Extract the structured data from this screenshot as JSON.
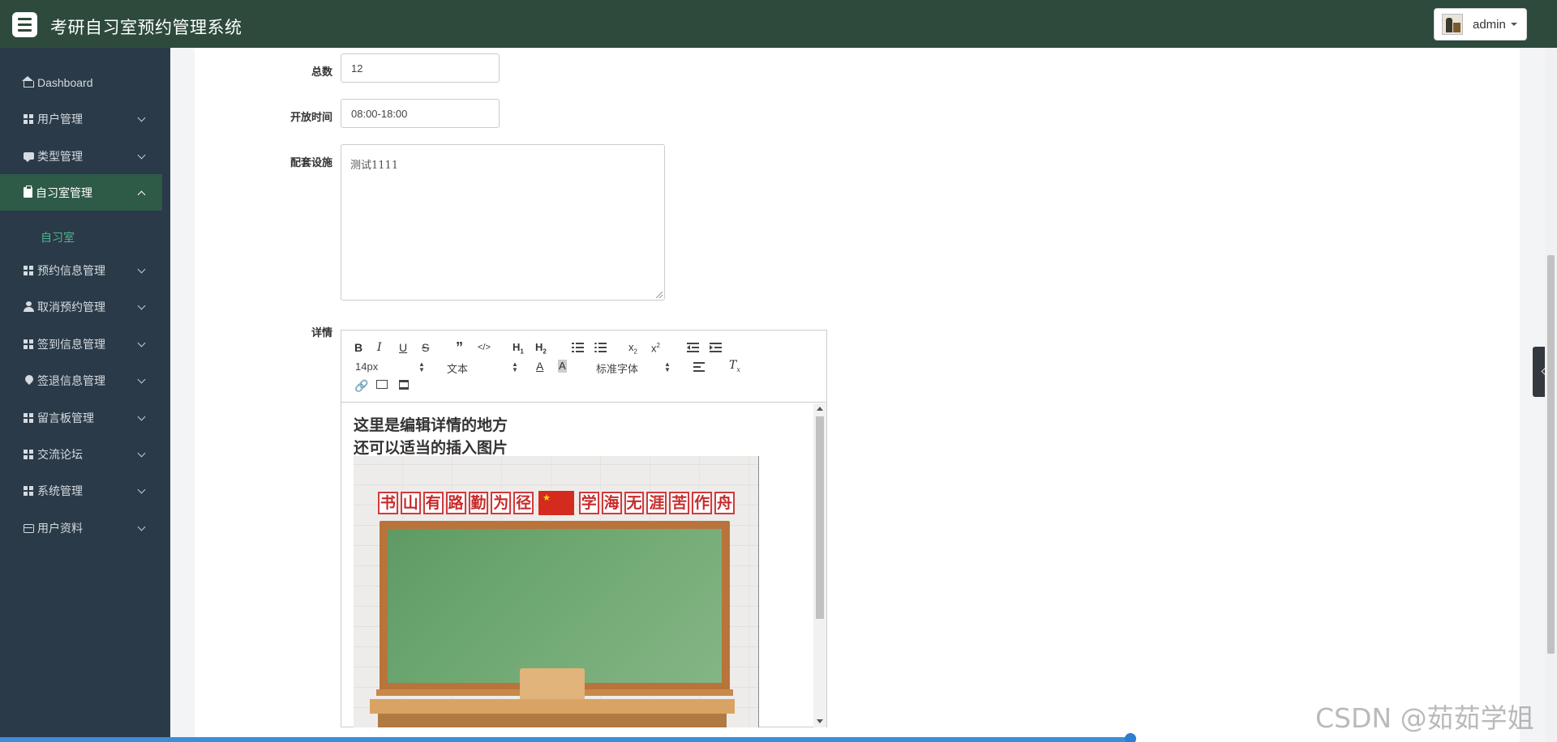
{
  "header": {
    "app_title": "考研自习室预约管理系统",
    "user_name": "admin"
  },
  "sidebar": {
    "items": [
      {
        "label": "Dashboard",
        "icon": "home-icon"
      },
      {
        "label": "用户管理",
        "icon": "grid-icon"
      },
      {
        "label": "类型管理",
        "icon": "comment-icon"
      },
      {
        "label": "自习室管理",
        "icon": "clipboard-icon",
        "active": true
      },
      {
        "label": "预约信息管理",
        "icon": "grid-icon"
      },
      {
        "label": "取消预约管理",
        "icon": "user-icon"
      },
      {
        "label": "签到信息管理",
        "icon": "grid-icon"
      },
      {
        "label": "签退信息管理",
        "icon": "pin-icon"
      },
      {
        "label": "留言板管理",
        "icon": "grid-icon"
      },
      {
        "label": "交流论坛",
        "icon": "grid-icon"
      },
      {
        "label": "系统管理",
        "icon": "grid-icon"
      },
      {
        "label": "用户资料",
        "icon": "card-icon"
      }
    ],
    "sub_item": "自习室"
  },
  "form": {
    "total_label": "总数",
    "total_value": "12",
    "hours_label": "开放时间",
    "hours_value": "08:00-18:00",
    "facilities_label": "配套设施",
    "facilities_value": "测试1111",
    "detail_label": "详情"
  },
  "editor": {
    "toolbar": {
      "font_size": "14px",
      "block_type": "文本",
      "font_family": "标准字体"
    },
    "content_line1": "这里是编辑详情的地方",
    "content_line2": "还可以适当的插入图片",
    "image_banner_left": [
      "书",
      "山",
      "有",
      "路",
      "勤",
      "为",
      "径"
    ],
    "image_banner_right": [
      "学",
      "海",
      "无",
      "涯",
      "苦",
      "作",
      "舟"
    ]
  },
  "colors": {
    "header_bg": "#2d4a3c",
    "sidebar_bg": "#2a3a48",
    "active_item_bg": "#2e5a48",
    "sub_item_color": "#4fb58a"
  },
  "watermark": "CSDN @茹茹学姐"
}
